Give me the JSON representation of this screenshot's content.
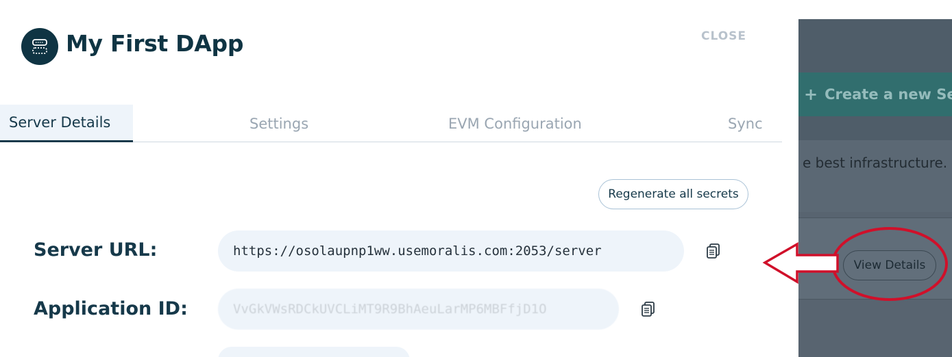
{
  "modal": {
    "title": "My First DApp",
    "close_label": "CLOSE",
    "logo_icon": "server-icon"
  },
  "tabs": [
    {
      "label": "Server Details",
      "active": true
    },
    {
      "label": "Settings",
      "active": false
    },
    {
      "label": "EVM Configuration",
      "active": false
    },
    {
      "label": "Sync",
      "active": false
    }
  ],
  "actions": {
    "regenerate_label": "Regenerate all secrets"
  },
  "fields": {
    "server_url": {
      "label": "Server URL:",
      "value": "https://osolaupnp1ww.usemoralis.com:2053/server",
      "copy_icon": "copy-icon"
    },
    "application_id": {
      "label": "Application ID:",
      "value": "VvGkVWsRDCkUVCLiMT9R9BhAeuLarMP6MBFfjD1O",
      "copy_icon": "copy-icon"
    }
  },
  "background": {
    "create_label": "Create a new Se",
    "infra_text": "e best infrastructure.",
    "view_details_label": "View Details"
  },
  "colors": {
    "brand_dark": "#0f3443",
    "tab_active_bg": "#eef4fa",
    "annotation_red": "#d0102a",
    "overlay": "#586470"
  }
}
